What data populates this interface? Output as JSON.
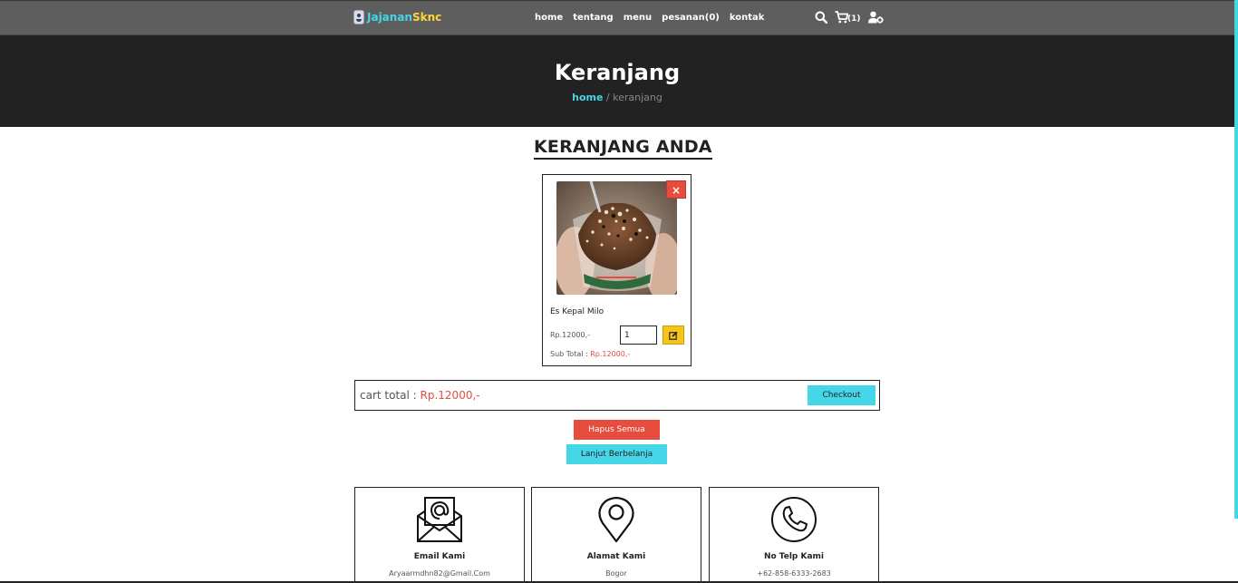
{
  "brand": {
    "part1": "Jajanan",
    "part2": "Sknc"
  },
  "nav": [
    "home",
    "tentang",
    "menu",
    "pesanan(0)",
    "kontak"
  ],
  "header_icons": {
    "search": "search-icon",
    "cart": "cart-icon",
    "cart_count": "(1)",
    "user": "user-gear-icon"
  },
  "hero": {
    "title": "Keranjang",
    "crumb_home": "home",
    "crumb_sep": " / ",
    "crumb_current": "keranjang"
  },
  "section_title": "KERANJANG ANDA",
  "cart_items": [
    {
      "name": "Es Kepal Milo",
      "price": "Rp.12000,-",
      "qty": "1",
      "subtotal_label": "Sub Total : ",
      "subtotal_value": "Rp.12000,-"
    }
  ],
  "cart_total": {
    "label": "cart total : ",
    "value": "Rp.12000,-",
    "checkout": "Checkout"
  },
  "buttons": {
    "clear_all": "Hapus Semua",
    "continue": "Lanjut Berbelanja"
  },
  "remove_glyph": "×",
  "contacts": [
    {
      "title": "Email Kami",
      "value": "Aryaarmdhn82@Gmail.Com",
      "icon": "email-icon"
    },
    {
      "title": "Alamat Kami",
      "value": "Bogor",
      "icon": "location-pin-icon"
    },
    {
      "title": "No Telp Kami",
      "value": "+62-858-6333-2683",
      "icon": "phone-icon"
    }
  ],
  "colors": {
    "accent": "#45d6e8",
    "danger": "#e74c3c",
    "warning": "#f5c518",
    "brand_yellow": "#ffd43b",
    "header": "#5e5e5e",
    "hero": "#222222"
  }
}
